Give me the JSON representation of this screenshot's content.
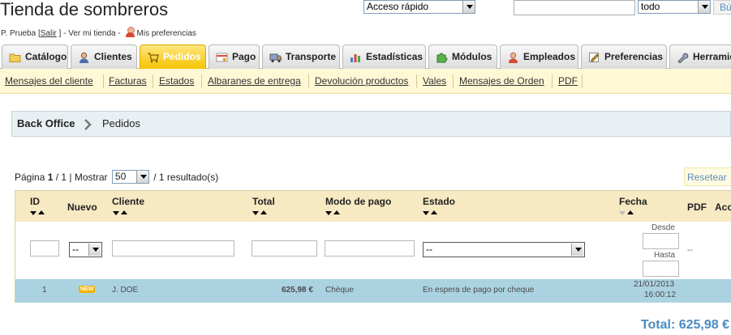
{
  "header": {
    "shop_title": "Tienda de sombreros",
    "quick_access": "Acceso rápido",
    "search_value": "",
    "search_scope": "todo",
    "search_button": "Bú"
  },
  "user_bar": {
    "name": "P. Prueba",
    "logout_open": "[",
    "logout": "Salir",
    "logout_close": "]",
    "sep1": "-",
    "view_shop": "Ver mi tienda",
    "sep2": "-",
    "preferences": "Mis preferencias"
  },
  "tabs": [
    {
      "label": "Catálogo",
      "icon": "folder-icon"
    },
    {
      "label": "Clientes",
      "icon": "customers-icon"
    },
    {
      "label": "Pedidos",
      "icon": "cart-icon",
      "active": true
    },
    {
      "label": "Pago",
      "icon": "payment-icon"
    },
    {
      "label": "Transporte",
      "icon": "truck-icon"
    },
    {
      "label": "Estadísticas",
      "icon": "stats-icon"
    },
    {
      "label": "Módulos",
      "icon": "puzzle-icon"
    },
    {
      "label": "Empleados",
      "icon": "employee-icon"
    },
    {
      "label": "Preferencias",
      "icon": "preferences-icon"
    },
    {
      "label": "Herramientas",
      "icon": "wrench-icon"
    }
  ],
  "subtabs": [
    "Mensajes del cliente",
    "Facturas",
    "Estados",
    "Albaranes de entrega",
    "Devolución productos",
    "Vales",
    "Mensajes de Orden",
    "PDF"
  ],
  "breadcrumb": {
    "root": "Back Office",
    "current": "Pedidos"
  },
  "pagination": {
    "page_label": "Página",
    "page": "1",
    "of": "/ 1 | Mostrar",
    "per_page": "50",
    "results": "/ 1 resultado(s)"
  },
  "reset_button": "Resetear",
  "table": {
    "columns": {
      "id": "ID",
      "new": "Nuevo",
      "customer": "Cliente",
      "total": "Total",
      "payment": "Modo de pago",
      "status": "Estado",
      "date": "Fecha",
      "pdf": "PDF",
      "actions": "Acc"
    },
    "filters": {
      "new": "--",
      "status": "--",
      "date_from": "Desde",
      "date_to": "Hasta",
      "pdf": "--"
    },
    "rows": [
      {
        "id": "1",
        "new_badge": "NEW",
        "customer": "J. DOE",
        "total": "625,98 €",
        "payment": "Chèque",
        "status": "En espera de pago por cheque",
        "date": "21/01/2013",
        "time": "16:00:12"
      }
    ]
  },
  "total": "Total: 625,98 €",
  "colors": {
    "active_tab": "#f5c400",
    "header_row": "#f7e9c2",
    "data_row": "#abd2e1",
    "total_text": "#4a8bc2"
  }
}
